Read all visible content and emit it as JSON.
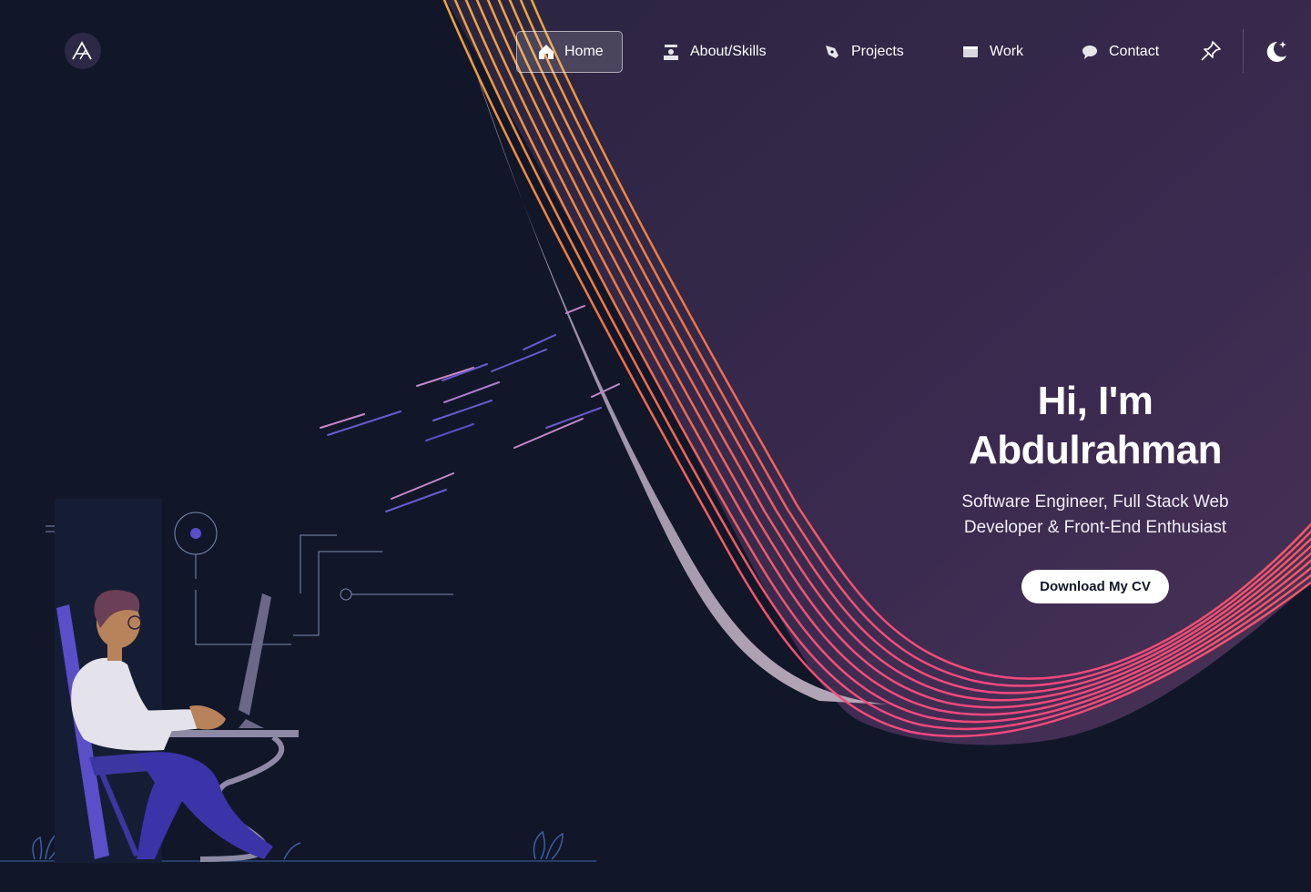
{
  "nav": {
    "items": [
      {
        "label": "Home",
        "icon": "home-icon",
        "active": true
      },
      {
        "label": "About/Skills",
        "icon": "person-desk-icon",
        "active": false
      },
      {
        "label": "Projects",
        "icon": "pen-tool-icon",
        "active": false
      },
      {
        "label": "Work",
        "icon": "window-icon",
        "active": false
      },
      {
        "label": "Contact",
        "icon": "chat-bubble-icon",
        "active": false
      }
    ],
    "tools": [
      "pin-icon",
      "moon-stars-icon"
    ]
  },
  "hero": {
    "greeting_line1": "Hi, I'm",
    "greeting_line2": "Abdulrahman",
    "subtitle_line1": "Software Engineer, Full Stack Web",
    "subtitle_line2": "Developer & Front-End Enthusiast",
    "cta_label": "Download My CV"
  },
  "colors": {
    "background": "#111729",
    "panel": "#3b2a50",
    "ribbon_light": "#a89bb0",
    "stripe_top": "#f0a23a",
    "stripe_bottom": "#f2507a",
    "accent_purple": "#5a4ec9"
  }
}
